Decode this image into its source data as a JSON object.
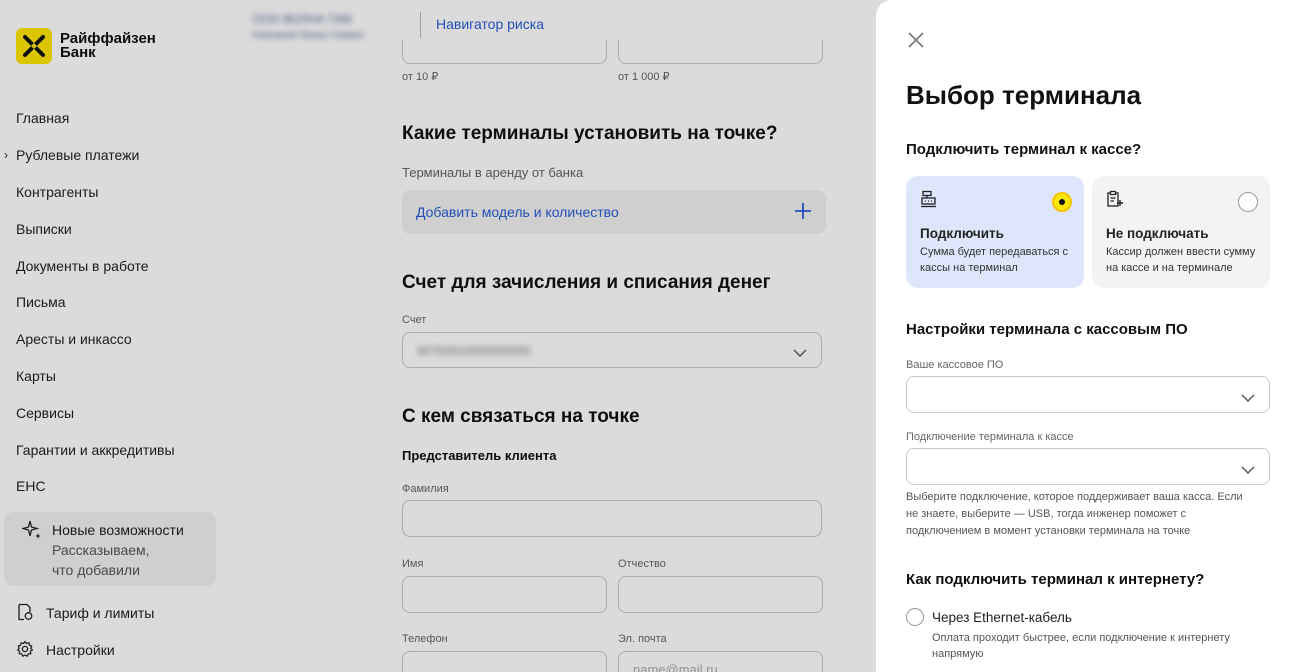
{
  "sidebar": {
    "logo_line1": "Райффайзен",
    "logo_line2": "Банк",
    "items": [
      {
        "label": "Главная"
      },
      {
        "label": "Рублевые платежи"
      },
      {
        "label": "Контрагенты"
      },
      {
        "label": "Выписки"
      },
      {
        "label": "Документы в работе"
      },
      {
        "label": "Письма"
      },
      {
        "label": "Аресты и инкассо"
      },
      {
        "label": "Карты"
      },
      {
        "label": "Сервисы"
      },
      {
        "label": "Гарантии и аккредитивы"
      },
      {
        "label": "ЕНС"
      }
    ],
    "new_features": {
      "title": "Новые возможности",
      "sub1": "Рассказываем,",
      "sub2": "что добавили"
    },
    "tariff": "Тариф и лимиты",
    "settings": "Настройки"
  },
  "topbar": {
    "company_blur": "ООО ВОЛНА ГАМ",
    "company_sub_blur": "Компания банка Сервис",
    "risk_navigator": "Навигатор риска"
  },
  "form": {
    "hint_left": "от 10 ₽",
    "hint_right": "от 1 000 ₽",
    "terminals_heading": "Какие терминалы установить на точке?",
    "rent_label": "Терминалы в аренду от банка",
    "add_model": "Добавить модель и количество",
    "account_heading": "Счет для зачисления и списания денег",
    "account_label": "Счет",
    "account_value_blur": "40702810000000000",
    "contact_heading": "С кем связаться на точке",
    "rep_heading": "Представитель клиента",
    "surname_label": "Фамилия",
    "name_label": "Имя",
    "patronymic_label": "Отчество",
    "phone_label": "Телефон",
    "email_label": "Эл. почта",
    "email_placeholder": "name@mail.ru"
  },
  "drawer": {
    "title": "Выбор терминала",
    "connect_question": "Подключить терминал к кассе?",
    "option_connect": {
      "title": "Подключить",
      "desc": "Сумма будет передаваться с кассы на терминал",
      "selected": true
    },
    "option_no_connect": {
      "title": "Не подключать",
      "desc": "Кассир должен ввести сумму на кассе и на терминале",
      "selected": false
    },
    "settings_heading": "Настройки терминала с кассовым ПО",
    "pos_software_label": "Ваше кассовое ПО",
    "connection_label": "Подключение терминала к кассе",
    "help_text": "Выберите подключение, которое поддерживает ваша касса. Если не знаете, выберите — USB, тогда инженер поможет с подключением в момент установки терминала на точке",
    "internet_heading": "Как подключить терминал к интернету?",
    "ethernet_label": "Через Ethernet-кабель",
    "ethernet_desc": "Оплата проходит быстрее, если подключение к интернету напрямую"
  },
  "colors": {
    "brand_yellow": "#fee600",
    "link_blue": "#2a5bd7",
    "selected_card": "#dde6fb"
  }
}
